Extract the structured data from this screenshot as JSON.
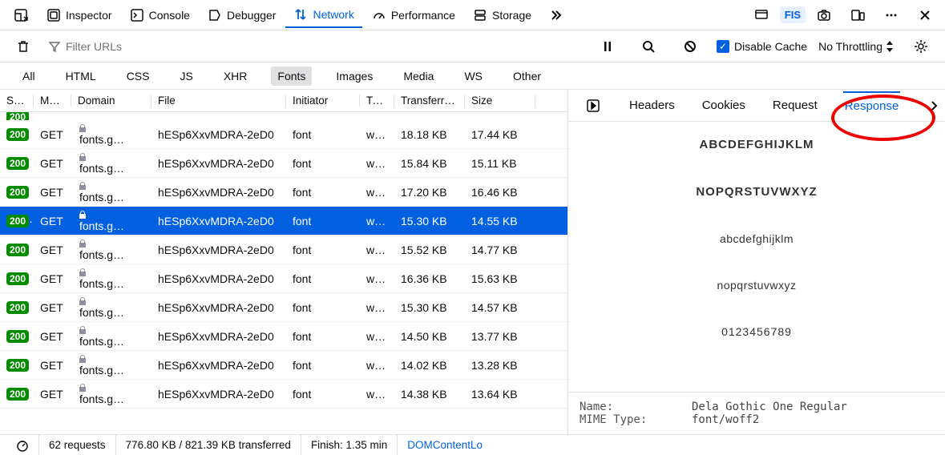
{
  "toolbar": {
    "inspector": "Inspector",
    "console": "Console",
    "debugger": "Debugger",
    "network": "Network",
    "performance": "Performance",
    "storage": "Storage",
    "fis": "FIS"
  },
  "sub": {
    "filter_placeholder": "Filter URLs",
    "disable_cache": "Disable Cache",
    "throttling": "No Throttling"
  },
  "filters": {
    "all": "All",
    "html": "HTML",
    "css": "CSS",
    "js": "JS",
    "xhr": "XHR",
    "fonts": "Fonts",
    "images": "Images",
    "media": "Media",
    "ws": "WS",
    "other": "Other"
  },
  "columns": {
    "status": "St…",
    "method": "M…",
    "domain": "Domain",
    "file": "File",
    "initiator": "Initiator",
    "type": "Ty…",
    "transferred": "Transferr…",
    "size": "Size"
  },
  "rows": [
    {
      "status": "200",
      "method": "GET",
      "domain": "fonts.g…",
      "file": "hESp6XxvMDRA-2eD0",
      "initiator": "font",
      "type": "w…",
      "transferred": "18.18 KB",
      "size": "17.44 KB"
    },
    {
      "status": "200",
      "method": "GET",
      "domain": "fonts.g…",
      "file": "hESp6XxvMDRA-2eD0",
      "initiator": "font",
      "type": "w…",
      "transferred": "15.84 KB",
      "size": "15.11 KB"
    },
    {
      "status": "200",
      "method": "GET",
      "domain": "fonts.g…",
      "file": "hESp6XxvMDRA-2eD0",
      "initiator": "font",
      "type": "w…",
      "transferred": "17.20 KB",
      "size": "16.46 KB"
    },
    {
      "status": "200",
      "method": "GET",
      "domain": "fonts.g…",
      "file": "hESp6XxvMDRA-2eD0",
      "initiator": "font",
      "type": "w…",
      "transferred": "15.30 KB",
      "size": "14.55 KB",
      "selected": true
    },
    {
      "status": "200",
      "method": "GET",
      "domain": "fonts.g…",
      "file": "hESp6XxvMDRA-2eD0",
      "initiator": "font",
      "type": "w…",
      "transferred": "15.52 KB",
      "size": "14.77 KB"
    },
    {
      "status": "200",
      "method": "GET",
      "domain": "fonts.g…",
      "file": "hESp6XxvMDRA-2eD0",
      "initiator": "font",
      "type": "w…",
      "transferred": "16.36 KB",
      "size": "15.63 KB"
    },
    {
      "status": "200",
      "method": "GET",
      "domain": "fonts.g…",
      "file": "hESp6XxvMDRA-2eD0",
      "initiator": "font",
      "type": "w…",
      "transferred": "15.30 KB",
      "size": "14.57 KB"
    },
    {
      "status": "200",
      "method": "GET",
      "domain": "fonts.g…",
      "file": "hESp6XxvMDRA-2eD0",
      "initiator": "font",
      "type": "w…",
      "transferred": "14.50 KB",
      "size": "13.77 KB"
    },
    {
      "status": "200",
      "method": "GET",
      "domain": "fonts.g…",
      "file": "hESp6XxvMDRA-2eD0",
      "initiator": "font",
      "type": "w…",
      "transferred": "14.02 KB",
      "size": "13.28 KB"
    },
    {
      "status": "200",
      "method": "GET",
      "domain": "fonts.g…",
      "file": "hESp6XxvMDRA-2eD0",
      "initiator": "font",
      "type": "w…",
      "transferred": "14.38 KB",
      "size": "13.64 KB"
    }
  ],
  "detail_tabs": {
    "headers": "Headers",
    "cookies": "Cookies",
    "request": "Request",
    "response": "Response"
  },
  "preview": {
    "line1": "ABCDEFGHIJKLM",
    "line2": "NOPQRSTUVWXYZ",
    "line3": "abcdefghijklm",
    "line4": "nopqrstuvwxyz",
    "line5": "0123456789"
  },
  "meta": {
    "name_label": "Name:",
    "name_value": "Dela Gothic One Regular",
    "mime_label": "MIME Type:",
    "mime_value": "font/woff2"
  },
  "status": {
    "requests": "62 requests",
    "transferred": "776.80 KB / 821.39 KB transferred",
    "finish": "Finish: 1.35 min",
    "dcl": "DOMContentLo"
  }
}
